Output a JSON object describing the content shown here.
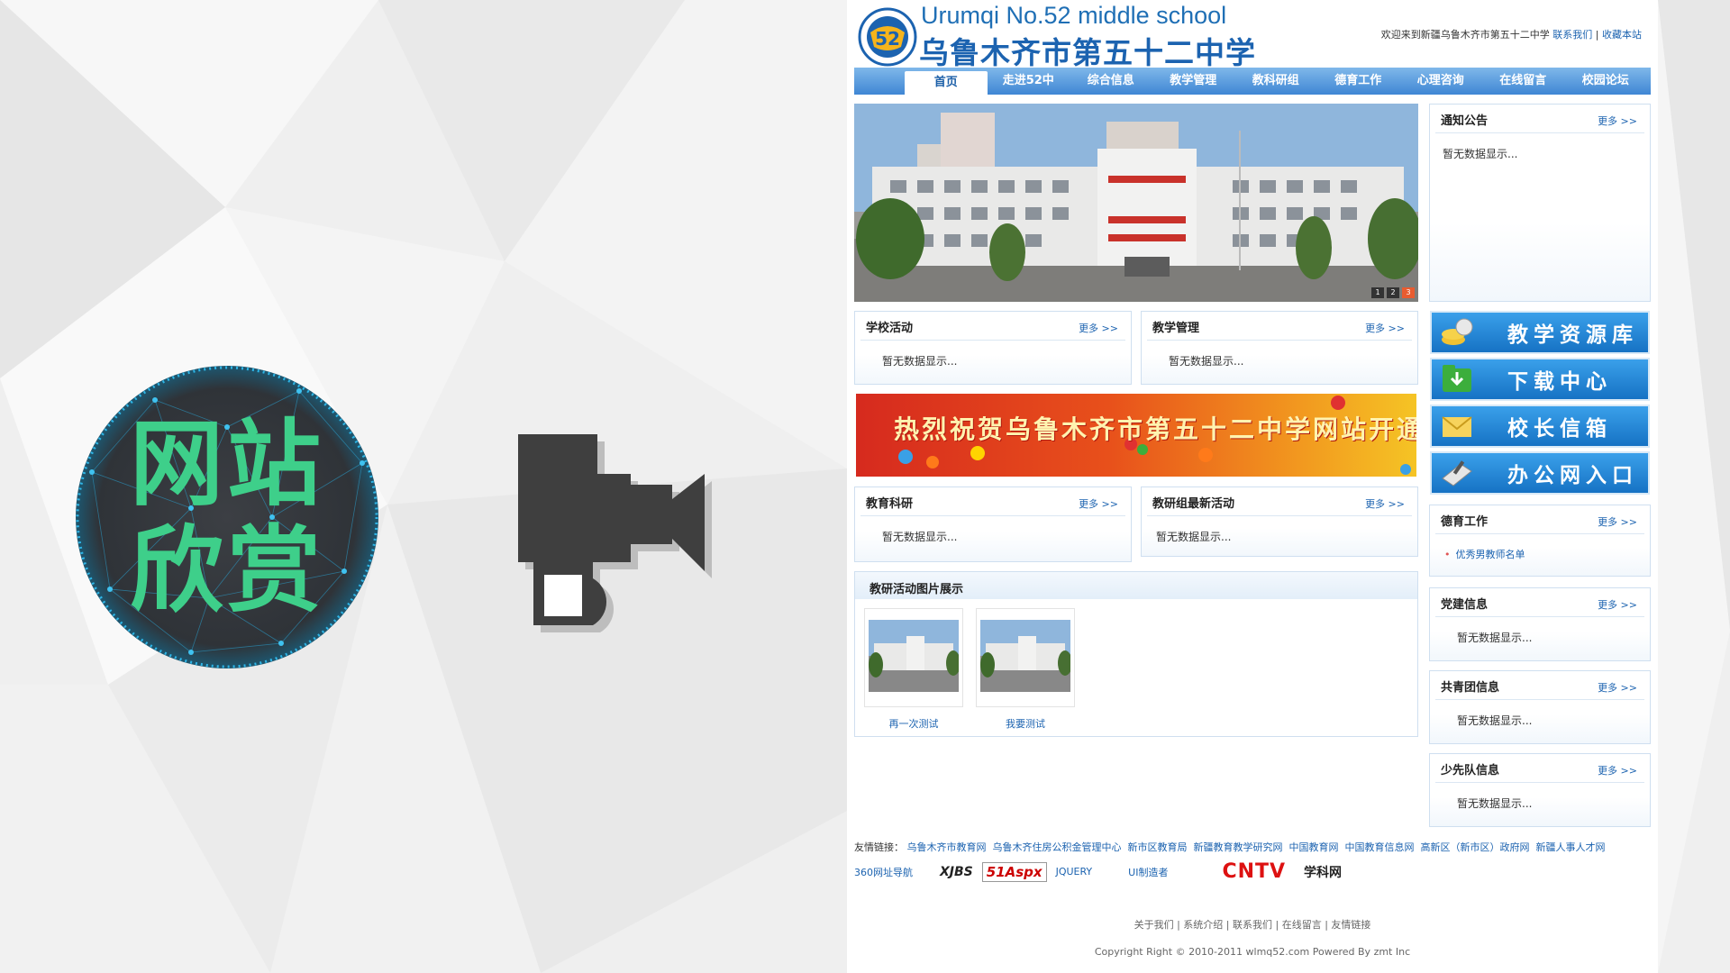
{
  "slide": {
    "badge_line1": "网站",
    "badge_line2": "欣赏",
    "badge_color": "#3ecf8a",
    "camera_icon": "video-camera-icon"
  },
  "site": {
    "logo_icon": "school-logo-icon",
    "school_name_en": "Urumqi No.52 middle school",
    "school_name_cn": "乌鲁木齐市第五十二中学",
    "welcome": "欢迎来到新疆乌鲁木齐市第五十二中学",
    "contact_link": "联系我们",
    "favorite_link": "收藏本站",
    "nav": [
      "首页",
      "走进52中",
      "综合信息",
      "教学管理",
      "教科研组",
      "德育工作",
      "心理咨询",
      "在线留言",
      "校园论坛"
    ],
    "more": "更多 >>",
    "empty": "暂无数据显示...",
    "banner_dots": [
      "1",
      "2",
      "3"
    ],
    "notice": {
      "title": "通知公告",
      "content": "暂无数据显示..."
    },
    "activities": {
      "title": "学校活动",
      "content": "暂无数据显示..."
    },
    "teaching": {
      "title": "教学管理",
      "content": "暂无数据显示..."
    },
    "ad_text": "热烈祝贺乌鲁木齐市第五十二中学网站开通",
    "research": {
      "title": "教育科研",
      "content": "暂无数据显示..."
    },
    "group_activity": {
      "title": "教研组最新活动",
      "content": "暂无数据显示..."
    },
    "gallery": {
      "title": "教研活动图片展示",
      "items": [
        "再一次测试",
        "我要测试"
      ]
    },
    "side_buttons": [
      {
        "label": "教学资源库",
        "icon": "coins-icon"
      },
      {
        "label": "下载中心",
        "icon": "folder-download-icon"
      },
      {
        "label": "校长信箱",
        "icon": "mail-icon"
      },
      {
        "label": "办公网入口",
        "icon": "office-icon"
      }
    ],
    "moral": {
      "title": "德育工作",
      "item": "优秀男教师名单"
    },
    "party": {
      "title": "党建信息",
      "content": "暂无数据显示..."
    },
    "league": {
      "title": "共青团信息",
      "content": "暂无数据显示..."
    },
    "pioneer": {
      "title": "少先队信息",
      "content": "暂无数据显示..."
    },
    "links_label": "友情链接：",
    "links": [
      "乌鲁木齐市教育网",
      "乌鲁木齐住房公积金管理中心",
      "新市区教育局",
      "新疆教育教学研究网",
      "中国教育网",
      "中国教育信息网",
      "高新区（新市区）政府网",
      "新疆人事人才网"
    ],
    "links_row2": [
      "360网址导航",
      "JQUERY",
      "UI制造者"
    ],
    "logo_badges": [
      "XJBS",
      "51Aspx",
      "CNTV",
      "学科网"
    ],
    "footer_links": [
      "关于我们",
      "系统介绍",
      "联系我们",
      "在线留言",
      "友情链接"
    ],
    "copyright": "Copyright Right © 2010-2011 wlmq52.com Powered By zmt Inc"
  }
}
